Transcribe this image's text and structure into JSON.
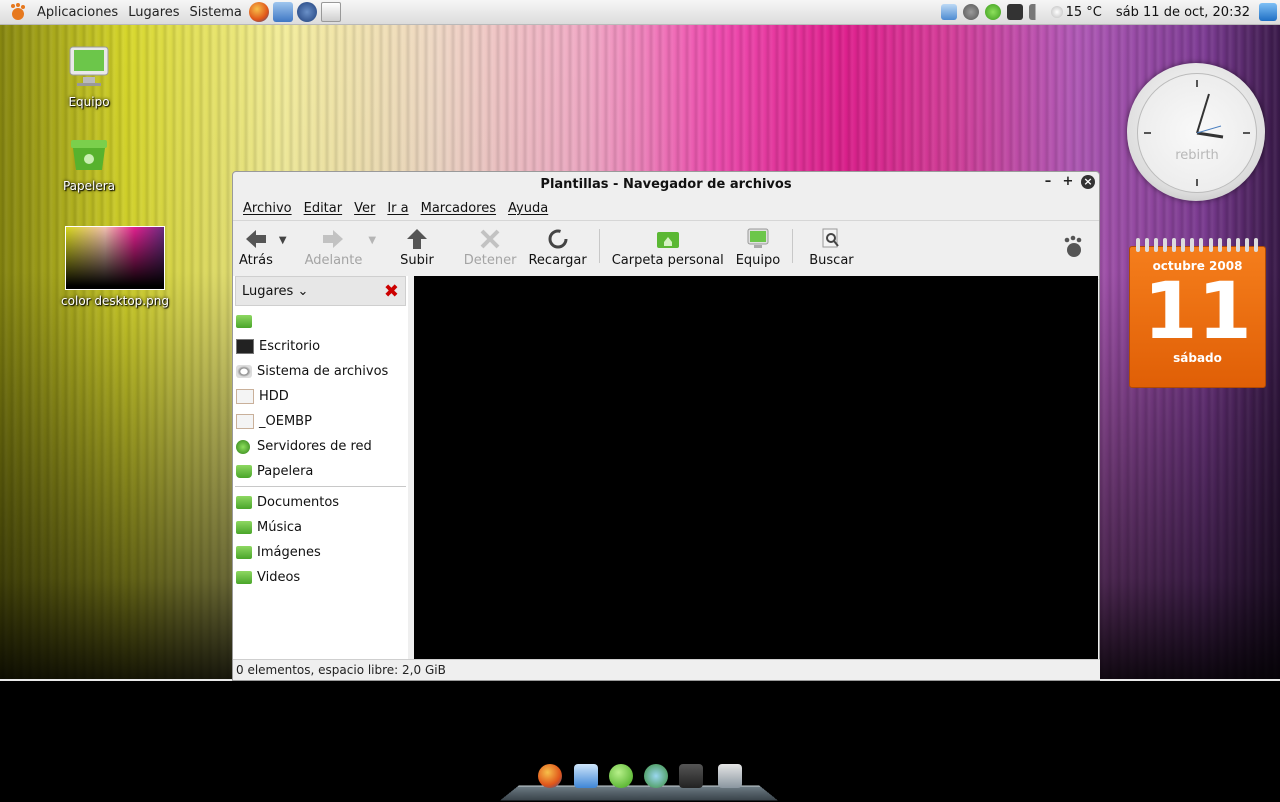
{
  "top_panel": {
    "menus": [
      "Aplicaciones",
      "Lugares",
      "Sistema"
    ],
    "launchers": [
      "firefox-icon",
      "update-icon",
      "music-player-icon",
      "text-editor-icon"
    ],
    "tray_icons": [
      "download-icon",
      "user-icon",
      "network-icon",
      "display-icon",
      "volume-icon",
      "weather-icon"
    ],
    "weather": "15 °C",
    "datetime": "sáb 11 de oct, 20:32"
  },
  "desktop": {
    "icons": [
      {
        "label": "Equipo",
        "icon": "computer-icon"
      },
      {
        "label": "Papelera",
        "icon": "trash-icon"
      },
      {
        "label": "color desktop.png",
        "icon": "image-thumbnail"
      }
    ]
  },
  "window": {
    "title": "Plantillas - Navegador de archivos",
    "controls": {
      "minimize": "–",
      "maximize": "+",
      "close": "×"
    },
    "menubar": [
      "Archivo",
      "Editar",
      "Ver",
      "Ir a",
      "Marcadores",
      "Ayuda"
    ],
    "toolbar": {
      "back": "Atrás",
      "forward": "Adelante",
      "up": "Subir",
      "stop": "Detener",
      "reload": "Recargar",
      "home": "Carpeta personal",
      "computer": "Equipo",
      "search": "Buscar"
    },
    "sidebar": {
      "header": "Lugares",
      "places": [
        {
          "label": "",
          "icon": "home-folder-icon"
        },
        {
          "label": "Escritorio",
          "icon": "desktop-icon"
        },
        {
          "label": "Sistema de archivos",
          "icon": "filesystem-icon"
        },
        {
          "label": "HDD",
          "icon": "drive-icon"
        },
        {
          "label": "_OEMBP",
          "icon": "drive-icon"
        },
        {
          "label": "Servidores de red",
          "icon": "network-icon"
        },
        {
          "label": "Papelera",
          "icon": "trash-icon"
        }
      ],
      "bookmarks": [
        {
          "label": "Documentos",
          "icon": "folder-icon"
        },
        {
          "label": "Música",
          "icon": "folder-icon"
        },
        {
          "label": "Imágenes",
          "icon": "folder-icon"
        },
        {
          "label": "Videos",
          "icon": "folder-icon"
        }
      ]
    },
    "status": "0 elementos, espacio libre: 2,0 GiB"
  },
  "clock_widget": {
    "brand": "rebirth"
  },
  "calendar_widget": {
    "month": "octubre 2008",
    "day": "11",
    "weekday": "sábado"
  },
  "dock": {
    "items": [
      "firefox-icon",
      "download-icon",
      "chat-icon",
      "contacts-icon",
      "media-icon",
      "home-icon"
    ]
  },
  "colors": {
    "accent_orange": "#e8680c",
    "folder_green": "#5bb834",
    "content_bg": "#000000"
  }
}
